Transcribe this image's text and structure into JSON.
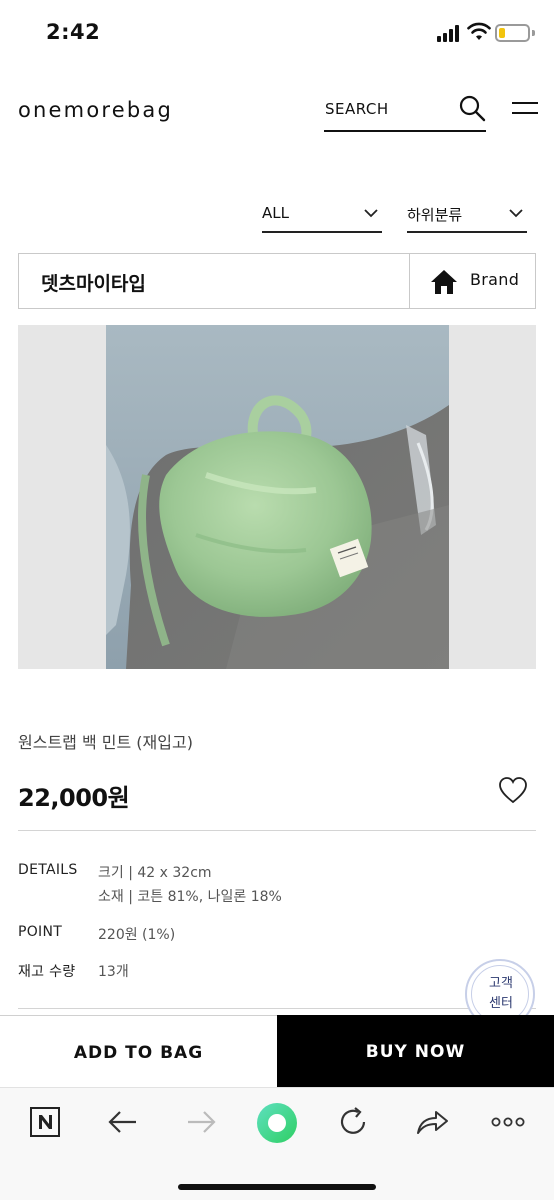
{
  "status_bar": {
    "time": "2:42"
  },
  "header": {
    "logo": "onemorebag",
    "search_label": "SEARCH"
  },
  "filters": [
    {
      "label": "ALL"
    },
    {
      "label": "하위분류"
    }
  ],
  "brand": {
    "name": "뎃츠마이타입",
    "button_label": "Brand"
  },
  "product": {
    "name": "원스트랩 백 민트 (재입고)",
    "price": "22,000원",
    "details_label": "DETAILS",
    "details_size": "크기 | 42 x 32cm",
    "details_material": "소재 | 코튼 81%, 나일론 18%",
    "point_label": "POINT",
    "point_value": "220원 (1%)",
    "stock_label": "재고 수량",
    "stock_value": "13개"
  },
  "customer_service": {
    "line1": "고객",
    "line2": "센터"
  },
  "actions": {
    "add_to_bag": "ADD TO BAG",
    "buy_now": "BUY NOW"
  },
  "browser": {
    "icons": [
      "naver-n-icon",
      "back-arrow-icon",
      "forward-arrow-icon",
      "green-home-circle-icon",
      "reload-icon",
      "share-icon",
      "more-dots-icon"
    ]
  },
  "colors": {
    "accent_green": "#3fd6a0",
    "battery_yellow": "#f2c40e",
    "buy_now_bg": "#000000"
  }
}
